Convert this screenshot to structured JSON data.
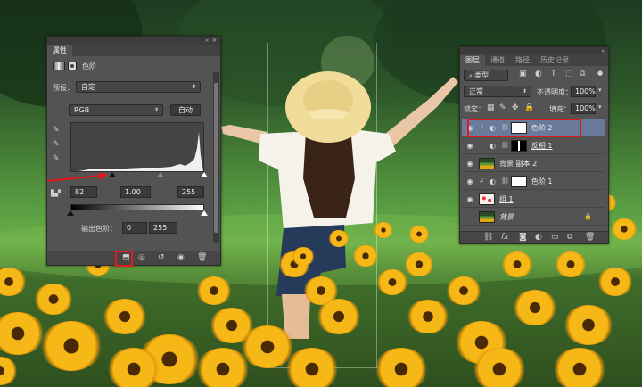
{
  "properties_panel": {
    "tab": "属性",
    "header_label": "色阶",
    "preset_label": "预设：",
    "preset_value": "自定",
    "channel_value": "RGB",
    "auto_button": "自动",
    "input_black": "82",
    "input_gamma": "1.00",
    "input_white": "255",
    "output_label": "输出色阶：",
    "output_black": "0",
    "output_white": "255",
    "collapse_glyph": "«",
    "close_glyph": "✕"
  },
  "layers_panel": {
    "tabs": [
      "图层",
      "通道",
      "路径",
      "历史记录"
    ],
    "filter_label": "类型",
    "blend_mode": "正常",
    "opacity_label": "不透明度：",
    "opacity_value": "100%",
    "lock_label": "锁定：",
    "fill_label": "填充：",
    "fill_value": "100%",
    "layers": [
      {
        "name": "色阶 2",
        "type": "levels",
        "thumb_color": "#ffffff",
        "selected": true
      },
      {
        "name": "反相 1",
        "type": "invert",
        "thumb_color": "#000000",
        "selected": false
      },
      {
        "name": "背景 副本 2",
        "type": "photo",
        "thumb_color": "#3e6a2a",
        "selected": false
      },
      {
        "name": "色阶 1",
        "type": "levels",
        "thumb_color": "#ffffff",
        "selected": false
      },
      {
        "name": "组 1",
        "type": "group",
        "thumb_color": "#f2d5d5",
        "selected": false
      },
      {
        "name": "背景",
        "type": "photo",
        "thumb_color": "#3e6a2a",
        "selected": false
      }
    ]
  },
  "colors": {
    "highlight_red": "#e11b1b",
    "panel_bg": "#535353",
    "selected_layer": "#6a7a9a"
  }
}
